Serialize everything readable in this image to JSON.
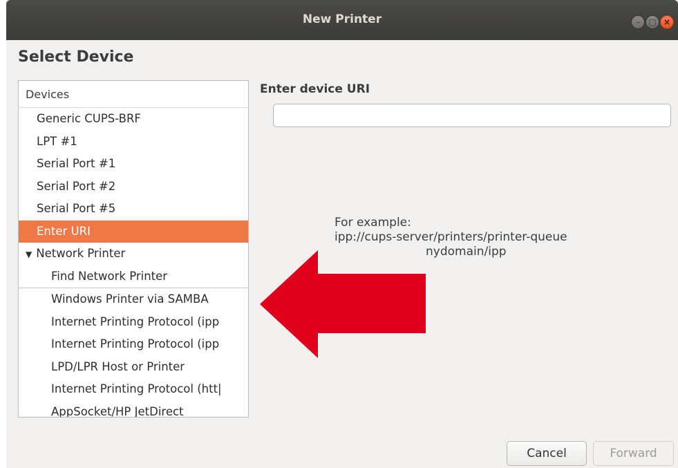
{
  "window": {
    "title": "New Printer",
    "controls": {
      "minimize": "–",
      "maximize": "□",
      "close": "×"
    }
  },
  "page": {
    "heading": "Select Device"
  },
  "devices": {
    "header": "Devices",
    "items": [
      {
        "label": "Generic CUPS-BRF",
        "level": 1,
        "selected": false
      },
      {
        "label": "LPT #1",
        "level": 1,
        "selected": false
      },
      {
        "label": "Serial Port #1",
        "level": 1,
        "selected": false
      },
      {
        "label": "Serial Port #2",
        "level": 1,
        "selected": false
      },
      {
        "label": "Serial Port #5",
        "level": 1,
        "selected": false
      },
      {
        "label": "Enter URI",
        "level": 1,
        "selected": true
      },
      {
        "label": "Network Printer",
        "level": 0,
        "expanded": true,
        "toggle_glyph": "▼"
      },
      {
        "label": "Find Network Printer",
        "level": 2
      },
      {
        "label": "Windows Printer via SAMBA",
        "level": 2
      },
      {
        "label": "Internet Printing Protocol (ipp",
        "level": 2
      },
      {
        "label": "Internet Printing Protocol (ipp",
        "level": 2
      },
      {
        "label": "LPD/LPR Host or Printer",
        "level": 2
      },
      {
        "label": "Internet Printing Protocol (htt|",
        "level": 2
      },
      {
        "label": "AppSocket/HP JetDirect",
        "level": 2
      }
    ]
  },
  "uri": {
    "label": "Enter device URI",
    "value": "",
    "example_line1": "For example:",
    "example_line2": "ipp://cups-server/printers/printer-queue",
    "example_line3": "nydomain/ipp"
  },
  "buttons": {
    "cancel": "Cancel",
    "forward": "Forward"
  },
  "colors": {
    "selection": "#f07746",
    "arrow": "#e0001b",
    "titlebar": "#3c3b37"
  }
}
